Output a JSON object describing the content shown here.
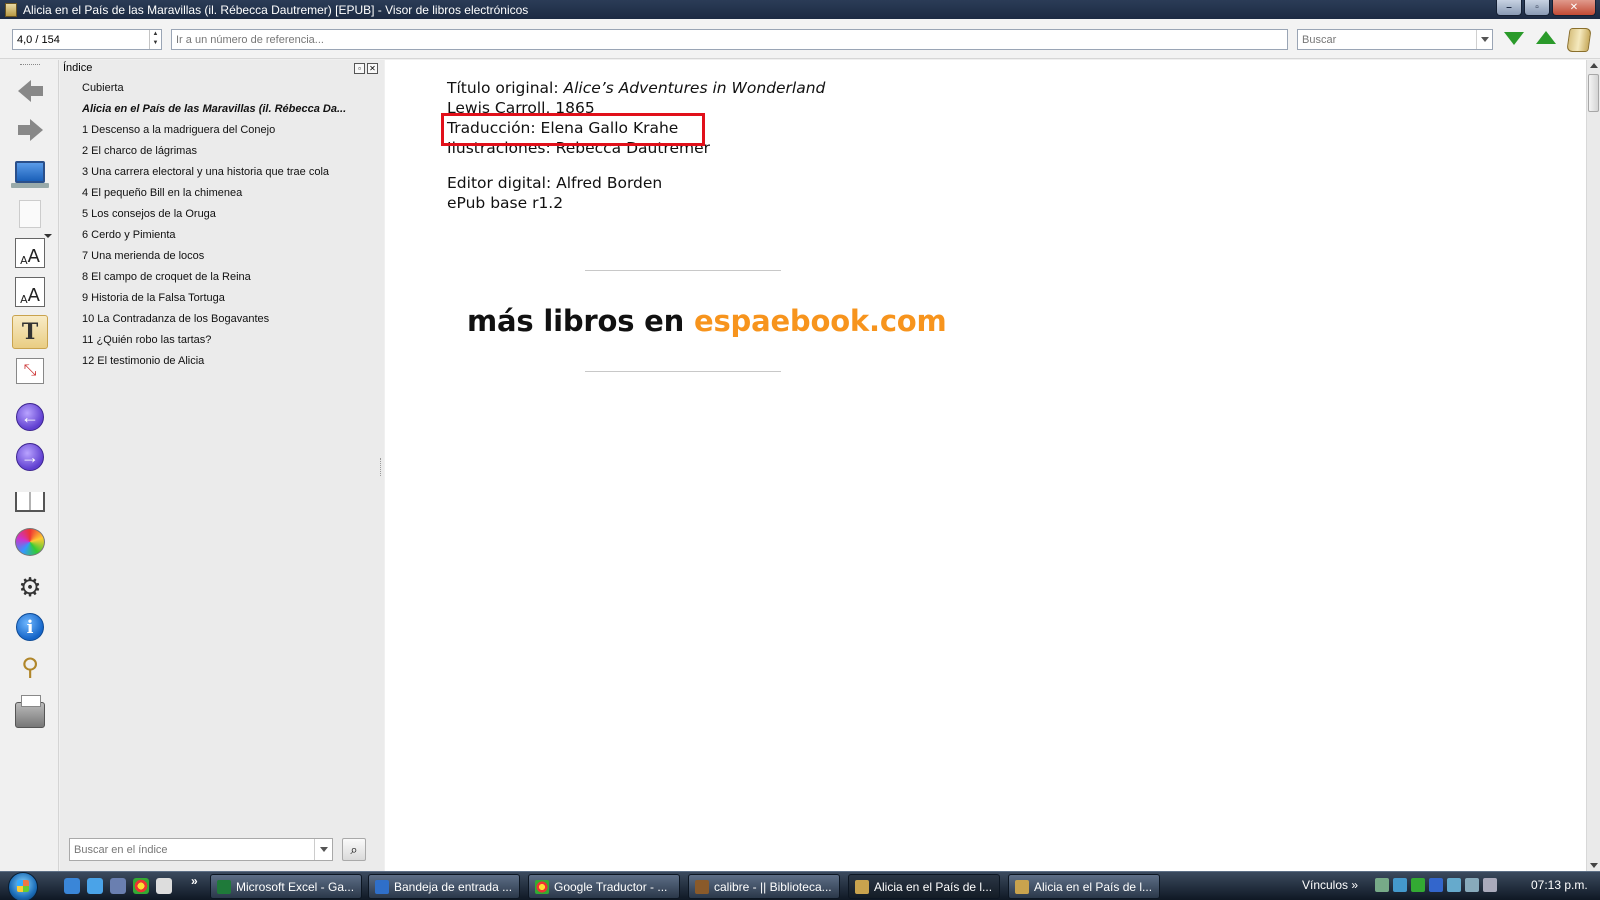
{
  "window": {
    "title": "Alicia en el País de las Maravillas (il. Rébecca Dautremer) [EPUB] - Visor de libros electrónicos",
    "controls": [
      "minimize",
      "maximize",
      "close"
    ]
  },
  "toolbar": {
    "page_position": "4,0 / 154",
    "reference_placeholder": "Ir a un número de referencia...",
    "search_placeholder": "Buscar"
  },
  "toc": {
    "title": "Índice",
    "items": [
      "Cubierta",
      "Alicia en el País de las Maravillas (il. Rébecca Da...",
      "1 Descenso a la madriguera del Conejo",
      "2 El charco de lágrimas",
      "3 Una carrera electoral y una historia que trae cola",
      "4 El pequeño Bill en la chimenea",
      "5 Los consejos de la Oruga",
      "6 Cerdo y Pimienta",
      "7 Una merienda de locos",
      "8 El campo de croquet de la Reina",
      "9 Historia de la Falsa Tortuga",
      "10 La Contradanza de los Bogavantes",
      "11 ¿Quién robo las tartas?",
      "12 El testimonio de Alicia"
    ],
    "current_index": 1,
    "search_placeholder": "Buscar en el índice"
  },
  "content": {
    "original_title_label": "Título original: ",
    "original_title_value": "Alice’s Adventures in Wonderland",
    "author_line": "Lewis Carroll, 1865",
    "translation_line": "Traducción: Elena Gallo Krahe",
    "illustrations_line": "Ilustraciones: Rebecca Dautremer",
    "editor_line": "Editor digital: Alfred Borden",
    "base_line": "ePub base r1.2",
    "promo_prefix": "más libros en ",
    "promo_site": "espaebook.com"
  },
  "colors": {
    "highlight_box": "#e1101a",
    "promo_site": "#f7941d",
    "find_arrows": "#2a9a2a"
  },
  "taskbar": {
    "tasks": [
      "Microsoft Excel - Ga...",
      "Bandeja de entrada ...",
      "Google Traductor - ...",
      "calibre - || Biblioteca...",
      "Alicia en el País de l...",
      "Alicia en el País de l..."
    ],
    "tray_label": "Vínculos",
    "clock": "07:13 p.m."
  },
  "icons": {
    "sidebar": [
      "back-arrow-icon",
      "forward-arrow-icon",
      "monitor-icon",
      "page-icon",
      "font-larger-icon",
      "font-smaller-icon",
      "text-mode-icon",
      "fullscreen-icon",
      "previous-section-icon",
      "next-section-icon",
      "bookmarks-icon",
      "theme-icon",
      "settings-icon",
      "info-icon",
      "reference-mode-icon",
      "print-icon"
    ]
  }
}
